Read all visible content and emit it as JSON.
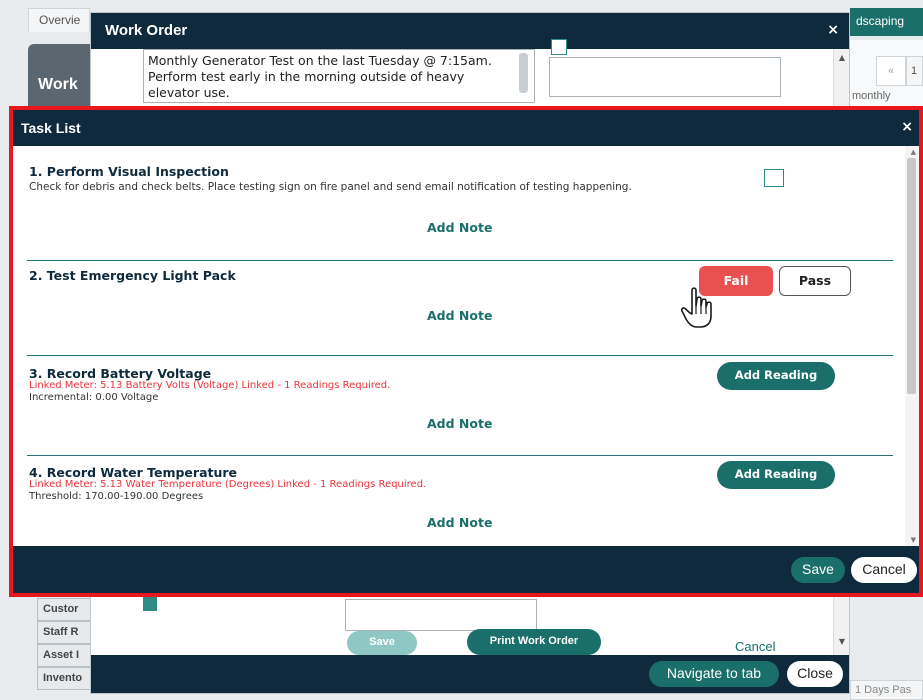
{
  "background": {
    "tab_overview": "Overvie",
    "tab_landscaping": "dscaping",
    "panel_label": "Work",
    "pager_prev": "«",
    "pager_next": "1",
    "frequency": "monthly",
    "side_items": [
      "Custor",
      "Staff R",
      "Asset I",
      "Invento"
    ],
    "days_label": "1 Days Pas"
  },
  "work_order": {
    "title": "Work Order",
    "close_icon": "×",
    "description": "Monthly Generator Test on the last Tuesday @ 7:15am. Perform test early in the morning outside of heavy elevator use.",
    "save_label": "Save",
    "print_label": "Print Work Order",
    "cancel_label": "Cancel",
    "navigate_label": "Navigate to tab",
    "close_label": "Close"
  },
  "task_list": {
    "title": "Task List",
    "close_icon": "×",
    "add_note_label": "Add Note",
    "tasks": [
      {
        "name": "1. Perform Visual Inspection",
        "description": "Check for debris and check belts. Place testing sign on fire panel and send email notification of testing happening."
      },
      {
        "name": "2. Test Emergency Light Pack",
        "fail_label": "Fail",
        "pass_label": "Pass"
      },
      {
        "name": "3. Record Battery Voltage",
        "meter": "Linked Meter: 5.13 Battery Volts (Voltage) Linked - 1 Readings Required.",
        "extra": "Incremental: 0.00 Voltage",
        "reading_label": "Add Reading"
      },
      {
        "name": "4. Record Water Temperature",
        "meter": "Linked Meter: 5.13 Water Temperature (Degrees) Linked - 1 Readings Required.",
        "extra": "Threshold: 170.00-190.00 Degrees",
        "reading_label": "Add Reading"
      }
    ],
    "save_label": "Save",
    "cancel_label": "Cancel"
  },
  "colors": {
    "header_navy": "#0f2a3c",
    "teal": "#1b6f6a",
    "fail_red": "#e85150",
    "highlight_red": "#e8171e",
    "meter_red": "#e8333a"
  }
}
